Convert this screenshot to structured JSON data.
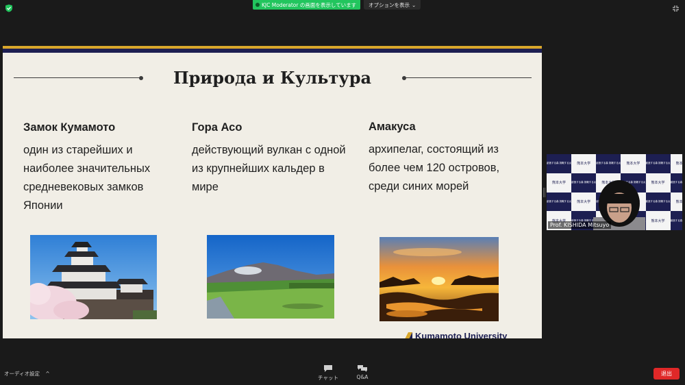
{
  "top_bar": {
    "share_banner": "KJC Moderator の画面を表示しています",
    "options_label": "オプションを表示",
    "options_chevron": "⌄"
  },
  "slide": {
    "title": "Природа и Культура",
    "columns": [
      {
        "heading": "Замок Кумамото",
        "body": "один из старейших и наиболее значительных средневековых замков Японии"
      },
      {
        "heading": "Гора Асо",
        "body": "действующий вулкан с одной из крупнейших кальдер в мире"
      },
      {
        "heading": "Амакуса",
        "body": "архипелаг, состоящий из более чем 120 островов, среди синих морей"
      }
    ],
    "logo_text": "Kumamoto University",
    "colors": {
      "navy": "#1d1f52",
      "gold": "#d9a72b",
      "background": "#f1eee6"
    }
  },
  "participant": {
    "name": "Prof. KISHIDA Mitsuyo",
    "background_label": "熊本大学",
    "background_label_alt": "創造する森 挑戦する炎"
  },
  "bottom_bar": {
    "audio_settings": "オーディオ設定",
    "audio_chevron": "^",
    "chat": "チャット",
    "qa": "Q&A",
    "leave": "退出"
  },
  "icons": {
    "security": "shield-check-icon",
    "exit_fullscreen": "exit-fullscreen-icon",
    "chat": "chat-bubble-icon",
    "qa": "qa-bubbles-icon"
  }
}
